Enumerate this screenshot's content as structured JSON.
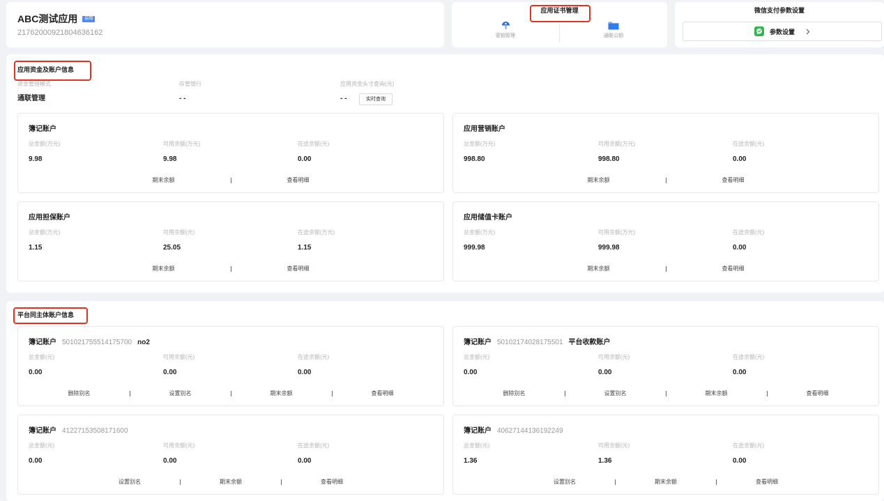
{
  "app": {
    "name": "ABC测试应用",
    "status_badge": "启用",
    "id": "21762000921804636162"
  },
  "cert_manage": {
    "title": "应用证书管理",
    "items": [
      {
        "label": "密钥管理",
        "icon": "key-icon"
      },
      {
        "label": "通联公钥",
        "icon": "folder-icon"
      }
    ]
  },
  "wechat_pay": {
    "title": "微信支付参数设置",
    "button_label": "参数设置",
    "icon": "wechat-icon"
  },
  "app_funds": {
    "title": "应用资金及账户信息",
    "info": [
      {
        "label": "资金管理模式",
        "value": "通联管理"
      },
      {
        "label": "存管银行",
        "value": "- -"
      },
      {
        "label": "应用资金头寸查询(元)",
        "value": "- -"
      }
    ],
    "query_button": "实时查询",
    "accounts": [
      {
        "title": "簿记账户",
        "fields": [
          {
            "label": "总金额(万元)",
            "value": "9.98"
          },
          {
            "label": "可用余额(万元)",
            "value": "9.98"
          },
          {
            "label": "在途余额(元)",
            "value": "0.00"
          }
        ],
        "links": [
          "期末余额",
          "查看明细"
        ]
      },
      {
        "title": "应用营销账户",
        "fields": [
          {
            "label": "总金额(万元)",
            "value": "998.80"
          },
          {
            "label": "可用余额(万元)",
            "value": "998.80"
          },
          {
            "label": "在途余额(元)",
            "value": "0.00"
          }
        ],
        "links": [
          "期末余额",
          "查看明细"
        ]
      },
      {
        "title": "应用担保账户",
        "fields": [
          {
            "label": "总金额(万元)",
            "value": "1.15"
          },
          {
            "label": "可用余额(元)",
            "value": "25.05"
          },
          {
            "label": "在途余额(万元)",
            "value": "1.15"
          }
        ],
        "links": [
          "期末余额",
          "查看明细"
        ]
      },
      {
        "title": "应用储值卡账户",
        "fields": [
          {
            "label": "总金额(万元)",
            "value": "999.98"
          },
          {
            "label": "可用余额(万元)",
            "value": "999.98"
          },
          {
            "label": "在途余额(元)",
            "value": "0.00"
          }
        ],
        "links": [
          "期末余额",
          "查看明细"
        ]
      }
    ]
  },
  "platform_accounts": {
    "title": "平台同主体账户信息",
    "accounts": [
      {
        "title": "簿记账户",
        "number": "501021755514175700",
        "alias": "no2",
        "fields": [
          {
            "label": "总金额(元)",
            "value": "0.00"
          },
          {
            "label": "可用余额(元)",
            "value": "0.00"
          },
          {
            "label": "在途余额(元)",
            "value": "0.00"
          }
        ],
        "links": [
          "删除别名",
          "设置别名",
          "期末余额",
          "查看明细"
        ]
      },
      {
        "title": "簿记账户",
        "number": "50102174028175501",
        "alias": "平台收款账户",
        "fields": [
          {
            "label": "总金额(元)",
            "value": "0.00"
          },
          {
            "label": "可用余额(元)",
            "value": "0.00"
          },
          {
            "label": "在途余额(元)",
            "value": "0.00"
          }
        ],
        "links": [
          "删除别名",
          "设置别名",
          "期末余额",
          "查看明细"
        ]
      },
      {
        "title": "簿记账户",
        "number": "41227153508171600",
        "fields": [
          {
            "label": "总金额(元)",
            "value": "0.00"
          },
          {
            "label": "可用余额(元)",
            "value": "0.00"
          },
          {
            "label": "在途余额(元)",
            "value": "0.00"
          }
        ],
        "links": [
          "设置别名",
          "期末余额",
          "查看明细"
        ]
      },
      {
        "title": "簿记账户",
        "number": "40627144136192249",
        "fields": [
          {
            "label": "总金额(元)",
            "value": "1.36"
          },
          {
            "label": "可用余额(元)",
            "value": "1.36"
          },
          {
            "label": "在途余额(元)",
            "value": "0.00"
          }
        ],
        "links": [
          "设置别名",
          "期末余额",
          "查看明细"
        ]
      }
    ]
  },
  "colors": {
    "highlight": "#e3321e",
    "badge": "#4d8cf5",
    "wechat_green": "#2db84d",
    "icon_blue": "#2f7cf0"
  }
}
